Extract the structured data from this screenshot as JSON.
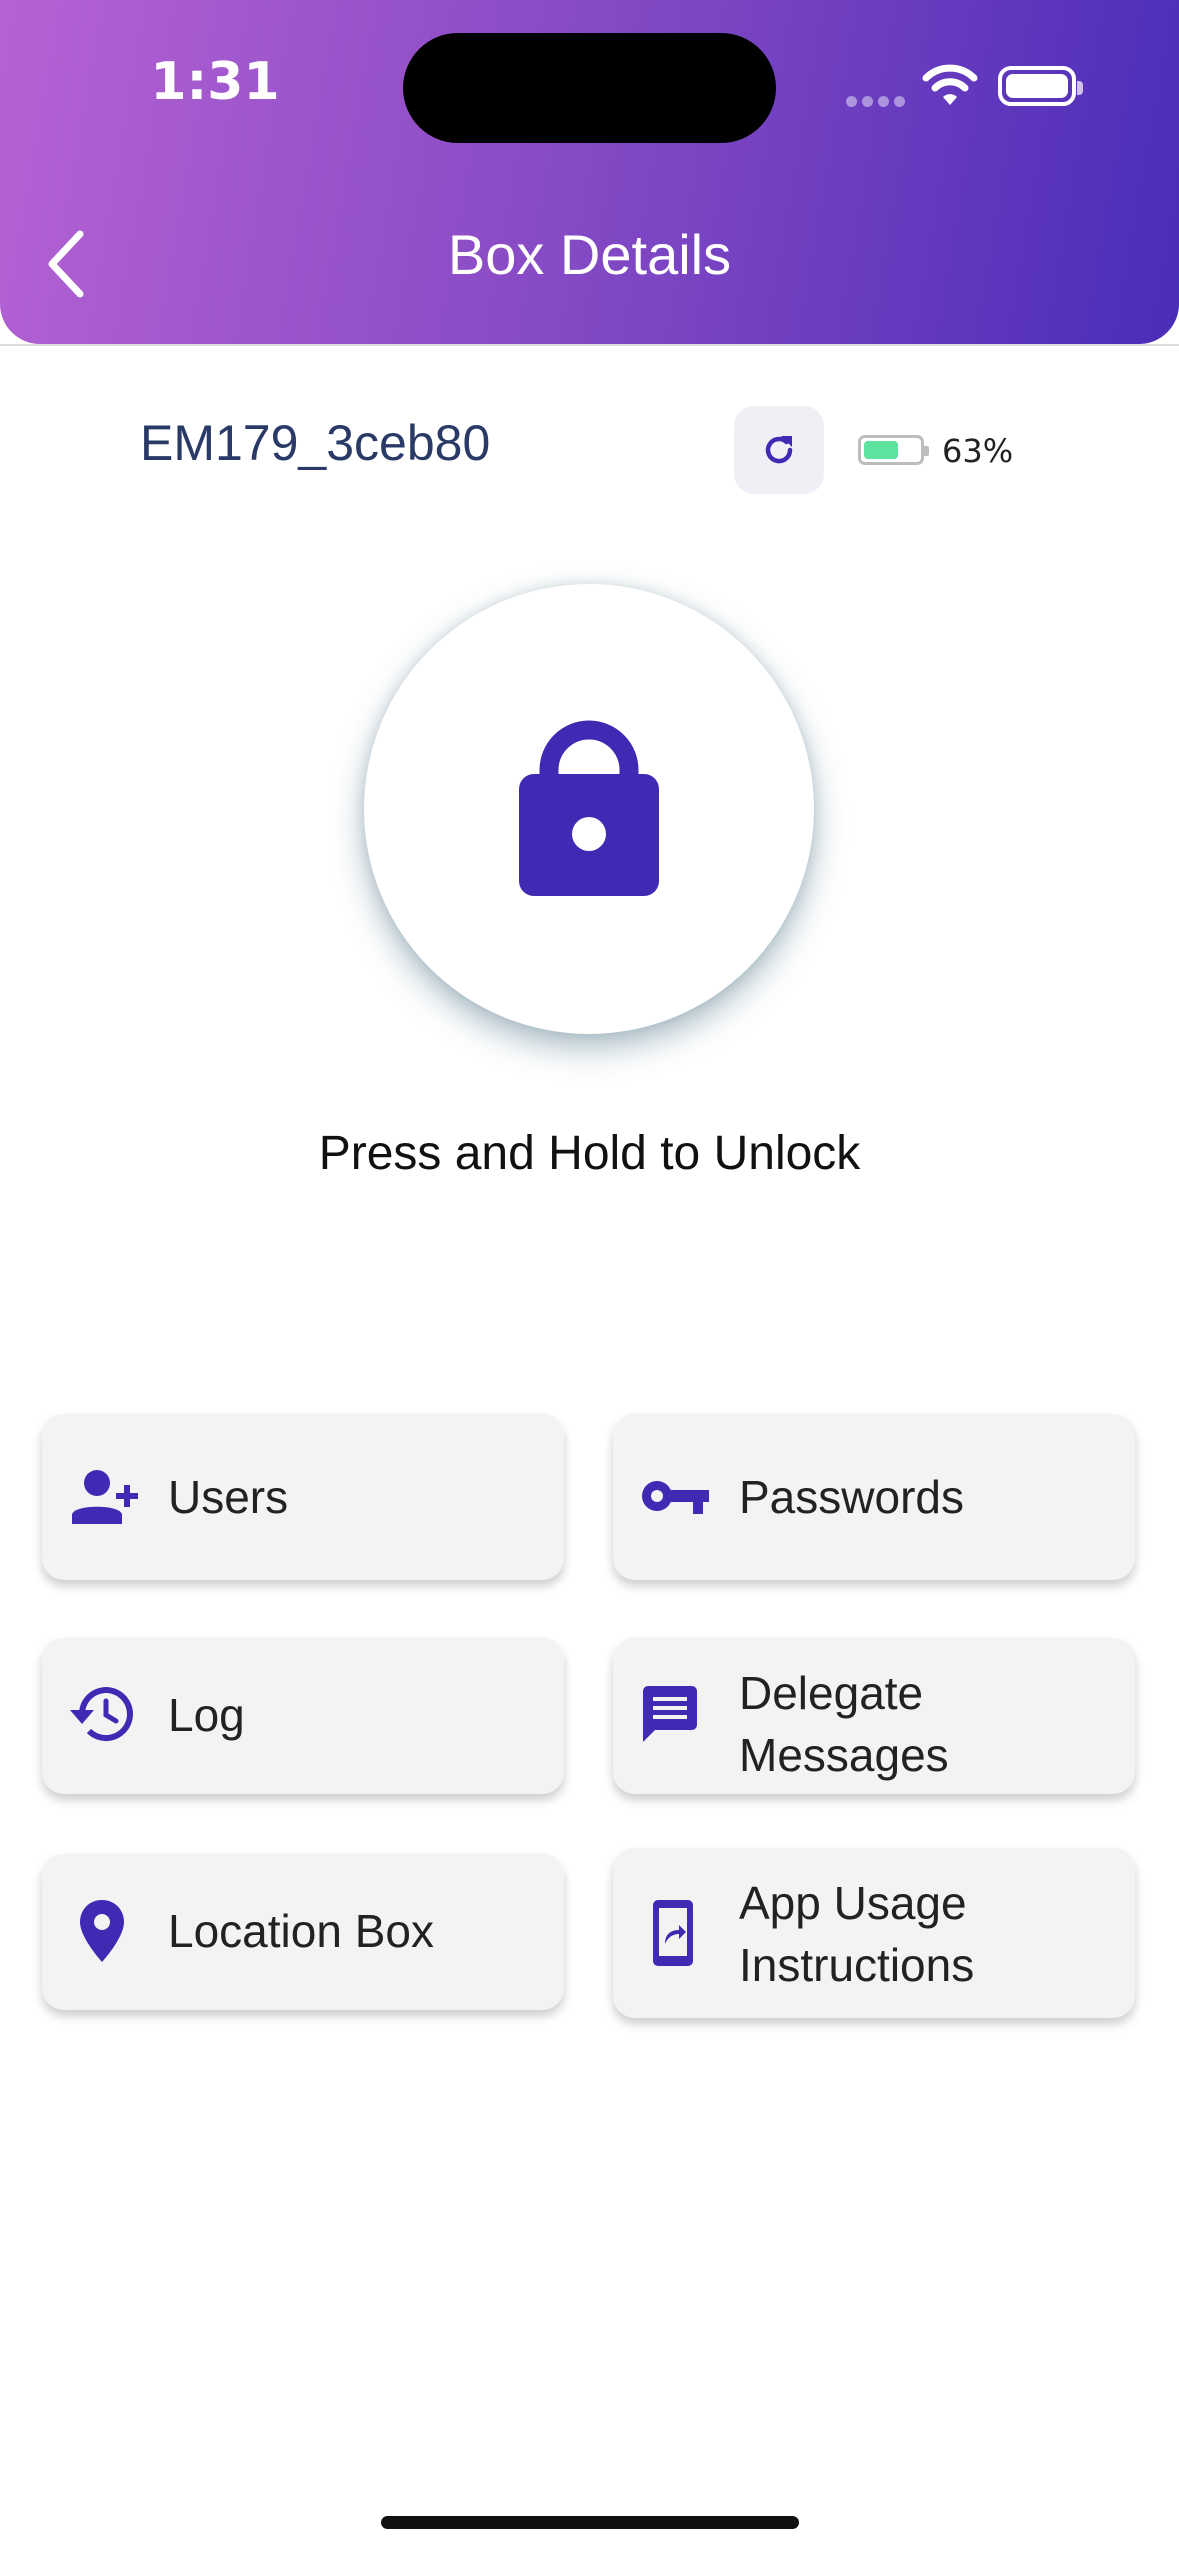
{
  "status_bar": {
    "time": "1:31"
  },
  "header": {
    "title": "Box Details"
  },
  "device": {
    "id": "EM179_3ceb80",
    "battery_percent": "63%",
    "battery_level": 0.63
  },
  "lock": {
    "instruction": "Press and Hold to Unlock"
  },
  "menu": {
    "users": "Users",
    "passwords": "Passwords",
    "log": "Log",
    "delegate_messages": "Delegate\nMessages",
    "location_box": "Location Box",
    "app_usage": "App Usage\nInstructions"
  },
  "colors": {
    "accent": "#3f2ab4",
    "header_start": "#b562d3",
    "header_end": "#4a2db8",
    "battery_fill": "#5ee2a0"
  }
}
